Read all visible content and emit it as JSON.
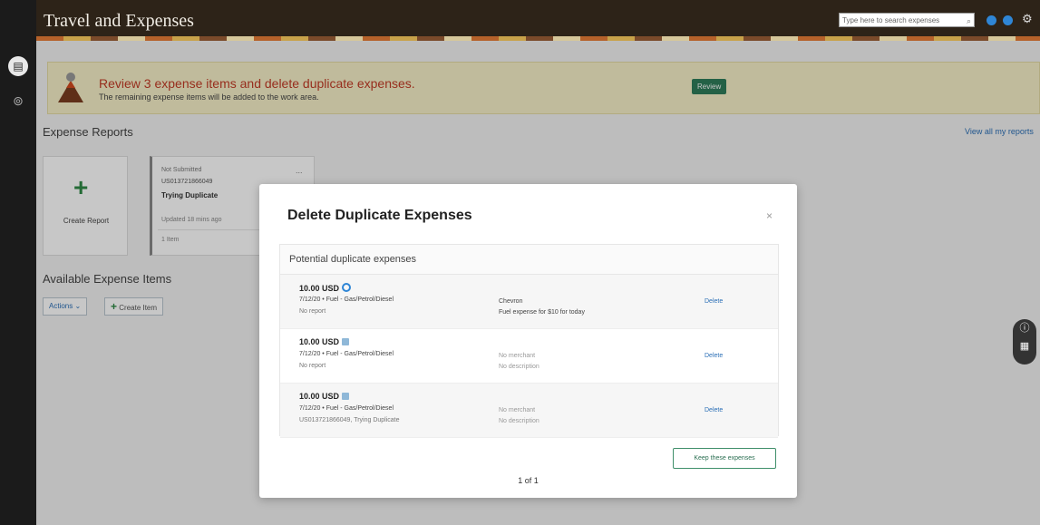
{
  "header": {
    "title": "Travel and Expenses",
    "search_placeholder": "Type here to search expenses"
  },
  "banner": {
    "title": "Review 3 expense items and delete duplicate expenses.",
    "subtitle": "The remaining expense items will be added to the work area.",
    "review_label": "Review"
  },
  "expense_reports": {
    "title": "Expense Reports",
    "view_all": "View all my reports",
    "create_label": "Create Report",
    "card": {
      "status": "Not Submitted",
      "number": "US013721866049",
      "name": "Trying Duplicate",
      "updated": "Updated 18 mins ago",
      "items": "1 Item",
      "more": "..."
    }
  },
  "available_items": {
    "title": "Available Expense Items",
    "actions_label": "Actions",
    "create_item_label": "Create Item"
  },
  "modal": {
    "title": "Delete Duplicate Expenses",
    "close": "×",
    "section_header": "Potential duplicate expenses",
    "rows": [
      {
        "amount": "10.00 USD",
        "line1": "7/12/20 • Fuel - Gas/Petrol/Diesel",
        "line2": "No report",
        "merchant": "Chevron",
        "description": "Fuel expense for $10 for today",
        "delete": "Delete"
      },
      {
        "amount": "10.00 USD",
        "line1": "7/12/20 • Fuel - Gas/Petrol/Diesel",
        "line2": "No report",
        "merchant": "No merchant",
        "description": "No description",
        "delete": "Delete"
      },
      {
        "amount": "10.00 USD",
        "line1": "7/12/20 • Fuel - Gas/Petrol/Diesel",
        "line2": "US013721866049, Trying Duplicate",
        "merchant": "No merchant",
        "description": "No description",
        "delete": "Delete"
      }
    ],
    "keep_label": "Keep these expenses",
    "pager": "1 of 1"
  },
  "icons": {
    "row1": "circle-icon",
    "row2": "card-icon",
    "row3": "card-icon"
  },
  "colors": {
    "banner_text": "#c23b26",
    "primary_button": "#2f7d5a",
    "link": "#2b6fb6"
  }
}
